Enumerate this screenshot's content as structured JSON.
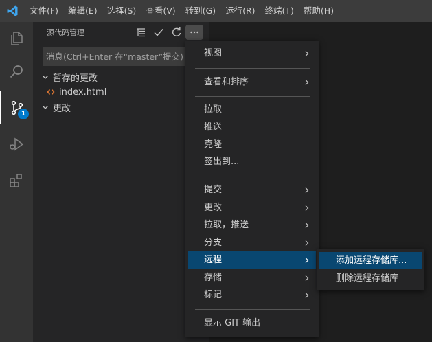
{
  "menubar": {
    "items": [
      "文件(F)",
      "编辑(E)",
      "选择(S)",
      "查看(V)",
      "转到(G)",
      "运行(R)",
      "终端(T)",
      "帮助(H)"
    ]
  },
  "activitybar": {
    "scm_badge": "1"
  },
  "sidebar": {
    "title": "源代码管理",
    "commit_placeholder": "消息(Ctrl+Enter 在“master”提交)",
    "staged_group": "暂存的更改",
    "staged_file": "index.html",
    "changes_group": "更改"
  },
  "context_menu": {
    "items": [
      {
        "label": "视图",
        "submenu": true
      },
      {
        "label": "查看和排序",
        "submenu": true
      },
      {
        "label": "拉取"
      },
      {
        "label": "推送"
      },
      {
        "label": "克隆"
      },
      {
        "label": "签出到..."
      },
      {
        "label": "提交",
        "submenu": true
      },
      {
        "label": "更改",
        "submenu": true
      },
      {
        "label": "拉取，推送",
        "submenu": true
      },
      {
        "label": "分支",
        "submenu": true
      },
      {
        "label": "远程",
        "submenu": true,
        "active": true
      },
      {
        "label": "存储",
        "submenu": true
      },
      {
        "label": "标记",
        "submenu": true
      },
      {
        "label": "显示 GIT 输出"
      }
    ]
  },
  "submenu": {
    "items": [
      {
        "label": "添加远程存储库...",
        "active": true
      },
      {
        "label": "删除远程存储库"
      }
    ]
  },
  "colors": {
    "accent": "#007acc",
    "selection": "#094771",
    "html_file_icon": "#e37933"
  }
}
